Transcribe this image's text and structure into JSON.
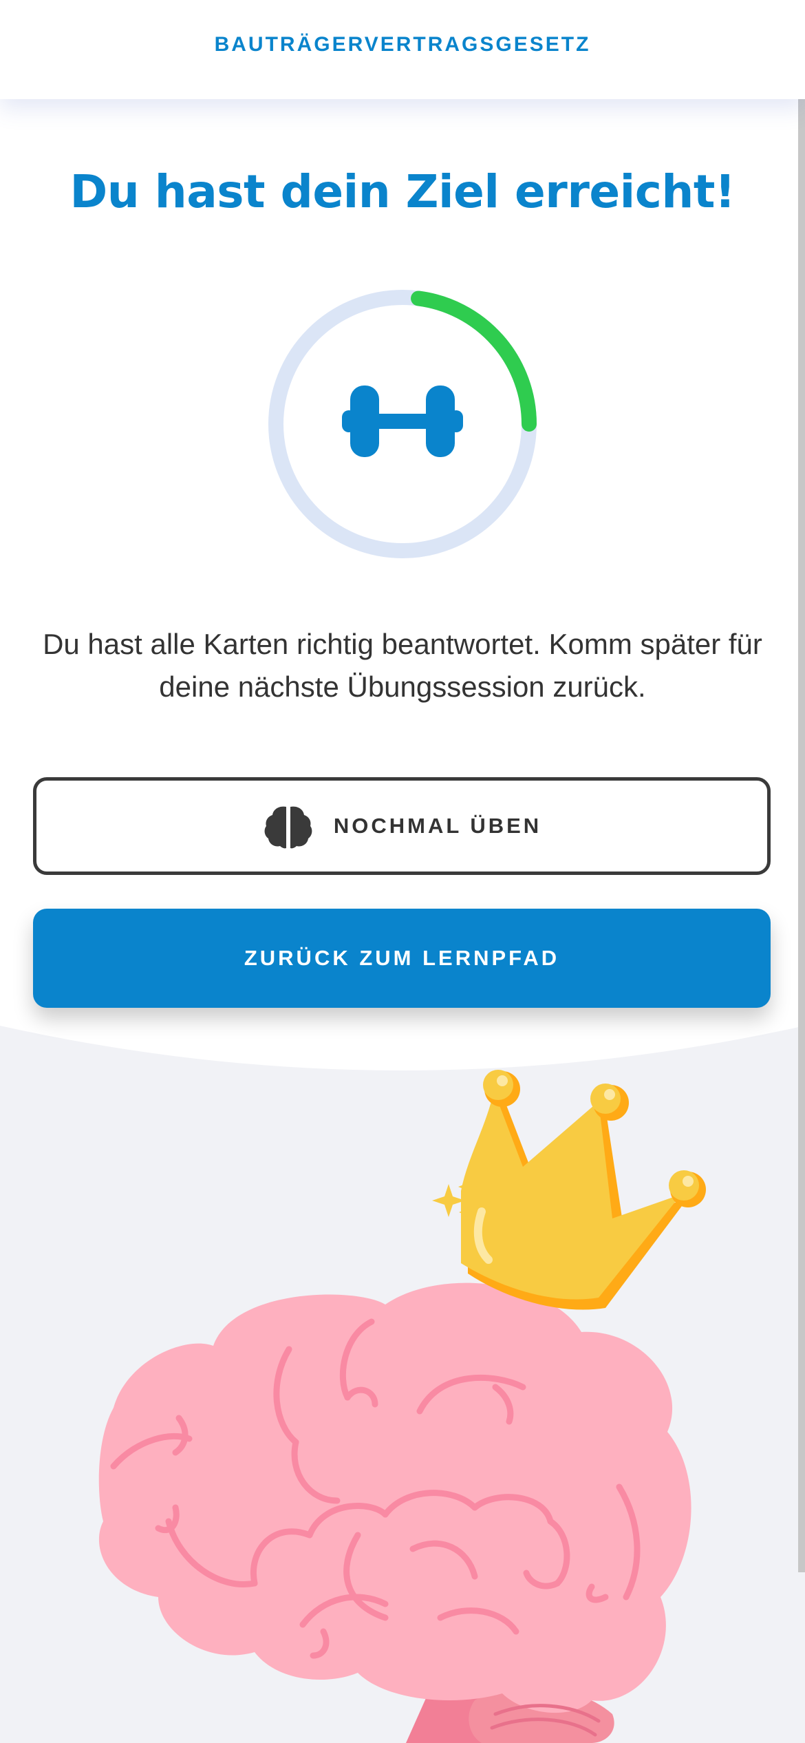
{
  "header": {
    "title": "BAUTRÄGERVERTRAGSGESETZ"
  },
  "result": {
    "headline": "Du hast dein Ziel erreicht!",
    "progress": 0.25,
    "message": "Du hast alle Karten richtig beantwortet. Komm später für deine nächste Übungssession zurück."
  },
  "actions": {
    "practice_again_label": "NOCHMAL ÜBEN",
    "practice_again_icon": "brain-icon",
    "back_to_path_label": "ZURÜCK ZUM LERNPFAD"
  },
  "icons": {
    "ring_center": "dumbbell-icon",
    "illustration": "brain-with-crown-illustration"
  },
  "colors": {
    "primary": "#0a84cc",
    "progress": "#2fcc4f",
    "track": "#dbe5f6",
    "text": "#333333",
    "background_bottom": "#f1f2f6",
    "brain": "#feb0bf",
    "crown": "#f8cb42"
  }
}
